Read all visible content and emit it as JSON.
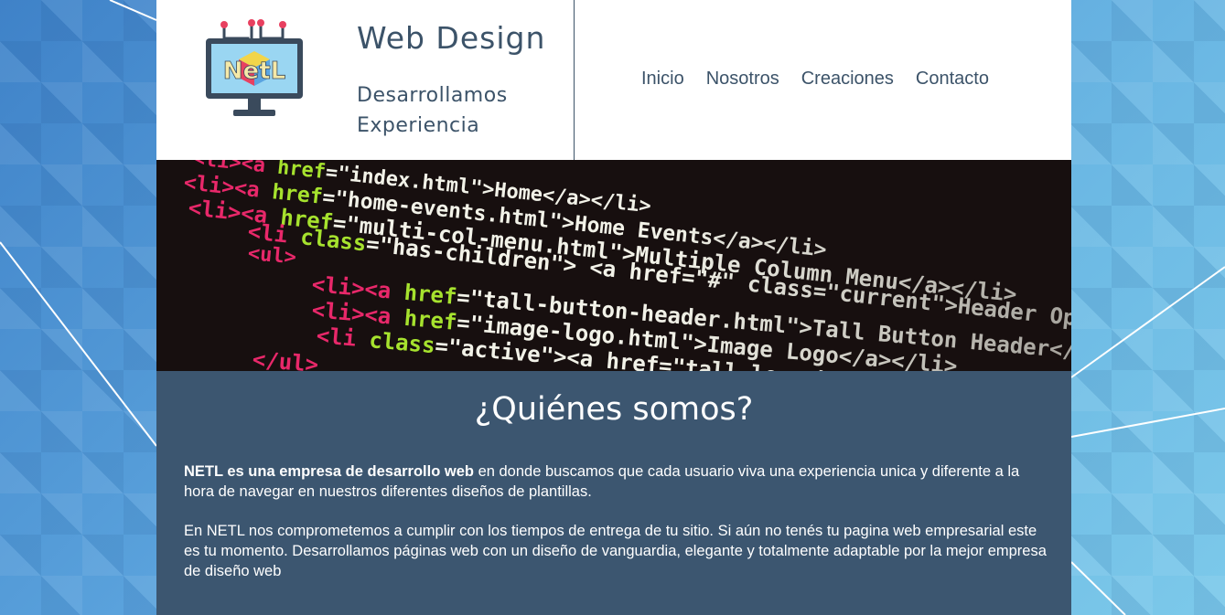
{
  "brand": {
    "title": "Web Design",
    "tagline": "Desarrollamos Experiencia",
    "logo_text": "NetL"
  },
  "nav": {
    "items": [
      {
        "label": "Inicio"
      },
      {
        "label": "Nosotros"
      },
      {
        "label": "Creaciones"
      },
      {
        "label": "Contacto"
      }
    ]
  },
  "hero": {
    "code_lines": [
      {
        "a": "<li><a ",
        "b": "href",
        "c": "=\"index.html\">Home</a></li>"
      },
      {
        "a": "<li><a ",
        "b": "href",
        "c": "=\"home-events.html\">Home Events</a></li>"
      },
      {
        "a": "<li><a ",
        "b": "href",
        "c": "=\"multi-col-menu.html\">Multiple Column Menu</a></li>"
      },
      {
        "a": "<li ",
        "b": "class",
        "c": "=\"has-children\"> <a href=\"#\" class=\"current\">Header Options</a>"
      },
      {
        "a": "<ul>",
        "b": "",
        "c": ""
      },
      {
        "a": "<li><a ",
        "b": "href",
        "c": "=\"tall-button-header.html\">Tall Button Header</a></li>"
      },
      {
        "a": "<li><a ",
        "b": "href",
        "c": "=\"image-logo.html\">Image Logo</a></li>"
      },
      {
        "a": "<li ",
        "b": "class",
        "c": "=\"active\"><a href=\"tall-logo.html\">"
      },
      {
        "a": "</ul>",
        "b": "",
        "c": ""
      }
    ]
  },
  "about": {
    "title": "¿Quiénes somos?",
    "p1_bold": "NETL es una empresa de desarrollo web",
    "p1_rest": " en donde buscamos que cada usuario viva una experiencia unica y diferente a la hora de navegar en nuestros diferentes diseños de plantillas.",
    "p2": "En NETL nos comprometemos a cumplir con los tiempos de entrega de tu sitio. Si aún no tenés tu pagina web empresarial este es tu momento. Desarrollamos páginas web con un diseño de vanguardia, elegante y totalmente adaptable por la mejor empresa de diseño web"
  },
  "colors": {
    "accent": "#3c5369",
    "about_bg": "#3c5670",
    "hero_bg": "#170f0f"
  }
}
